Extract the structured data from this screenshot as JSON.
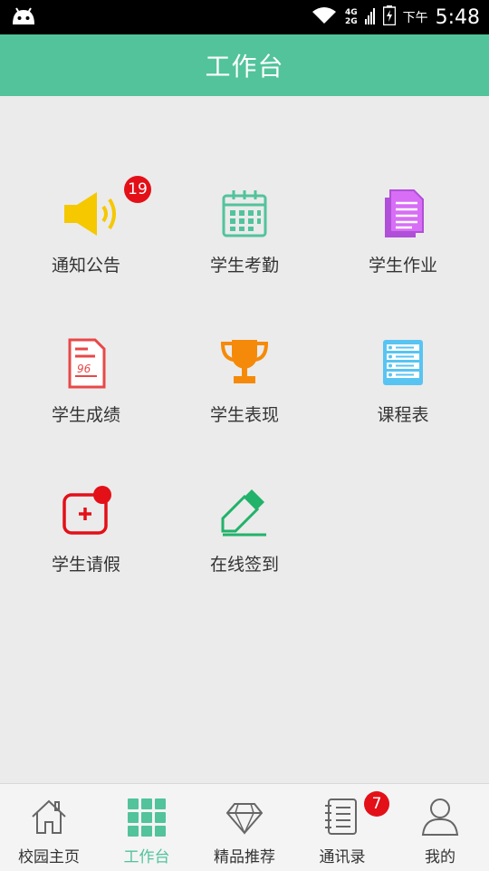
{
  "status_bar": {
    "network_top": "4G",
    "network_bottom": "2G",
    "ampm": "下午",
    "time": "5:48"
  },
  "header": {
    "title": "工作台"
  },
  "grid": {
    "items": [
      {
        "label": "通知公告",
        "icon": "speaker-icon",
        "badge": "19"
      },
      {
        "label": "学生考勤",
        "icon": "calendar-icon"
      },
      {
        "label": "学生作业",
        "icon": "document-icon"
      },
      {
        "label": "学生成绩",
        "icon": "score-sheet-icon"
      },
      {
        "label": "学生表现",
        "icon": "trophy-icon"
      },
      {
        "label": "课程表",
        "icon": "schedule-icon"
      },
      {
        "label": "学生请假",
        "icon": "leave-icon"
      },
      {
        "label": "在线签到",
        "icon": "pencil-icon"
      }
    ]
  },
  "tabbar": {
    "items": [
      {
        "label": "校园主页",
        "icon": "home-icon"
      },
      {
        "label": "工作台",
        "icon": "grid-icon",
        "active": true
      },
      {
        "label": "精品推荐",
        "icon": "diamond-icon"
      },
      {
        "label": "通讯录",
        "icon": "contacts-icon",
        "badge": "7"
      },
      {
        "label": "我的",
        "icon": "user-icon"
      }
    ]
  },
  "colors": {
    "brand": "#52c39b",
    "badge": "#e31018"
  }
}
